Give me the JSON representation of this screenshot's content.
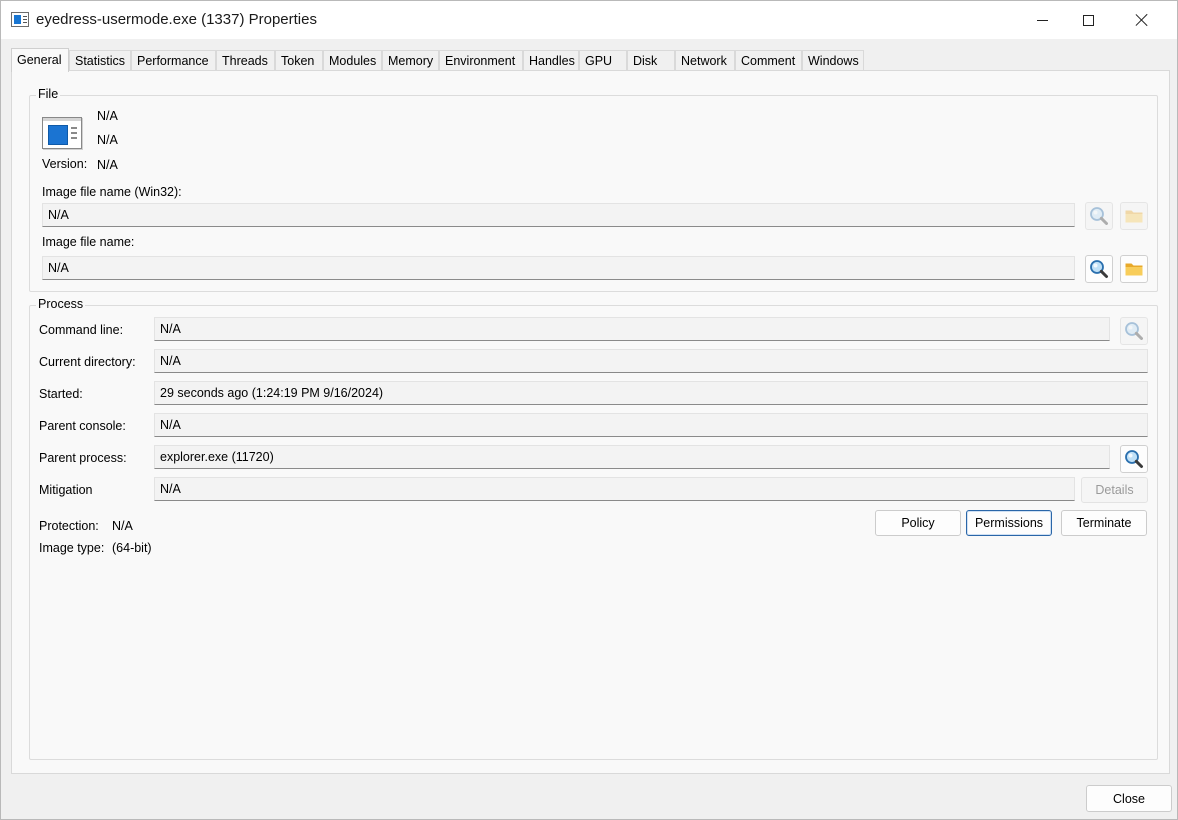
{
  "window": {
    "title": "eyedress-usermode.exe (1337) Properties"
  },
  "tabs": [
    {
      "label": "General",
      "active": true
    },
    {
      "label": "Statistics"
    },
    {
      "label": "Performance"
    },
    {
      "label": "Threads"
    },
    {
      "label": "Token"
    },
    {
      "label": "Modules"
    },
    {
      "label": "Memory"
    },
    {
      "label": "Environment"
    },
    {
      "label": "Handles"
    },
    {
      "label": "GPU"
    },
    {
      "label": "Disk"
    },
    {
      "label": "Network"
    },
    {
      "label": "Comment"
    },
    {
      "label": "Windows"
    }
  ],
  "file": {
    "group_label": "File",
    "description": "N/A",
    "company": "N/A",
    "version_label": "Version:",
    "version_value": "N/A",
    "image_win32_label": "Image file name (Win32):",
    "image_win32_value": "N/A",
    "image_label": "Image file name:",
    "image_value": "N/A"
  },
  "process": {
    "group_label": "Process",
    "command_line_label": "Command line:",
    "command_line_value": "N/A",
    "current_directory_label": "Current directory:",
    "current_directory_value": "N/A",
    "started_label": "Started:",
    "started_value": "29 seconds ago (1:24:19 PM 9/16/2024)",
    "parent_console_label": "Parent console:",
    "parent_console_value": "N/A",
    "parent_process_label": "Parent process:",
    "parent_process_value": "explorer.exe (11720)",
    "mitigation_label": "Mitigation",
    "mitigation_value": "N/A",
    "details_label": "Details",
    "protection_label": "Protection:",
    "protection_value": "N/A",
    "image_type_label": "Image type:",
    "image_type_value": "(64-bit)",
    "policy_label": "Policy",
    "permissions_label": "Permissions",
    "terminate_label": "Terminate"
  },
  "footer": {
    "close_label": "Close"
  },
  "icons": {
    "search": "magnifier-icon",
    "folder": "folder-icon"
  },
  "colors": {
    "accent": "#1b74d2",
    "focus_border": "#2a66a8",
    "folder": "#f2c14e"
  }
}
